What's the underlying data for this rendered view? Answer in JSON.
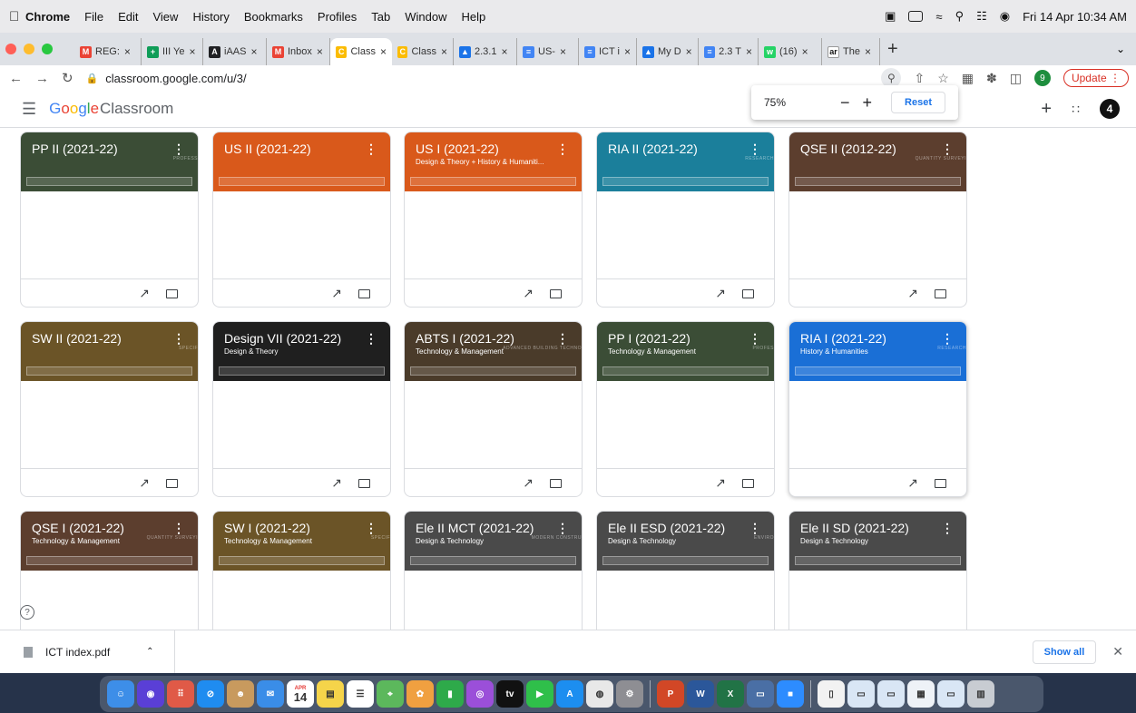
{
  "menubar": {
    "app": "Chrome",
    "items": [
      "File",
      "Edit",
      "View",
      "History",
      "Bookmarks",
      "Profiles",
      "Tab",
      "Window",
      "Help"
    ],
    "datetime": "Fri 14 Apr  10:34 AM"
  },
  "tabs": [
    {
      "label": "REG:",
      "icon": "gmail-icon",
      "color": "#ea4335",
      "glyph": "M"
    },
    {
      "label": "III Ye",
      "icon": "sheets-icon",
      "color": "#0f9d58",
      "glyph": "+"
    },
    {
      "label": "iAAS",
      "icon": "app-icon",
      "color": "#202124",
      "glyph": "A"
    },
    {
      "label": "Inbox",
      "icon": "gmail-icon",
      "color": "#ea4335",
      "glyph": "M"
    },
    {
      "label": "Class",
      "icon": "classroom-icon",
      "color": "#fbbc04",
      "glyph": "C",
      "active": true
    },
    {
      "label": "Class",
      "icon": "classroom-icon",
      "color": "#fbbc04",
      "glyph": "C"
    },
    {
      "label": "2.3.1",
      "icon": "drive-icon",
      "color": "#1a73e8",
      "glyph": "▲"
    },
    {
      "label": "US-",
      "icon": "docs-icon",
      "color": "#4285f4",
      "glyph": "≡"
    },
    {
      "label": "ICT i",
      "icon": "docs-icon",
      "color": "#4285f4",
      "glyph": "≡"
    },
    {
      "label": "My D",
      "icon": "drive-icon",
      "color": "#1a73e8",
      "glyph": "▲"
    },
    {
      "label": "2.3 T",
      "icon": "docs-icon",
      "color": "#4285f4",
      "glyph": "≡"
    },
    {
      "label": "(16)",
      "icon": "whatsapp-icon",
      "color": "#25d366",
      "glyph": "w"
    },
    {
      "label": "The",
      "icon": "ar-icon",
      "color": "#ffffff",
      "glyph": "ar"
    }
  ],
  "address": {
    "url": "classroom.google.com/u/3/",
    "profile_initial": "9",
    "update_label": "Update"
  },
  "header": {
    "logo_google": [
      "G",
      "o",
      "o",
      "g",
      "l",
      "e"
    ],
    "logo_classroom": "Classroom",
    "account_initial": "4"
  },
  "zoom": {
    "percent": "75%",
    "minus": "−",
    "plus": "+",
    "reset": "Reset"
  },
  "classes": [
    {
      "title": "PP II (2021-22)",
      "subtitle": "",
      "watermark": "PROFESS",
      "color": "#3b4d36"
    },
    {
      "title": "US II (2021-22)",
      "subtitle": "",
      "watermark": "",
      "color": "#d9591b"
    },
    {
      "title": "US I (2021-22)",
      "subtitle": "Design & Theory + History & Humaniti...",
      "watermark": "",
      "color": "#d9591b"
    },
    {
      "title": "RIA II (2021-22)",
      "subtitle": "",
      "watermark": "RESEARCH",
      "color": "#1b7f9b"
    },
    {
      "title": "QSE II (2012-22)",
      "subtitle": "",
      "watermark": "QUANTITY SURVEYI",
      "color": "#5c3e2e"
    },
    {
      "title": "SW II (2021-22)",
      "subtitle": "",
      "watermark": "SPECIF",
      "color": "#6b5427"
    },
    {
      "title": "Design VII (2021-22)",
      "subtitle": "Design & Theory",
      "watermark": "",
      "color": "#1f1f1f"
    },
    {
      "title": "ABTS I (2021-22)",
      "subtitle": "Technology & Management",
      "watermark": "ADVANCED BUILDING TECHNO",
      "color": "#4a3b2a"
    },
    {
      "title": "PP I (2021-22)",
      "subtitle": "Technology & Management",
      "watermark": "PROFES",
      "color": "#3b4d36"
    },
    {
      "title": "RIA I (2021-22)",
      "subtitle": "History & Humanities",
      "watermark": "RESEARCH",
      "color": "#1a6fd6"
    },
    {
      "title": "QSE I (2021-22)",
      "subtitle": "Technology & Management",
      "watermark": "QUANTITY SURVEYI",
      "color": "#5c3e2e"
    },
    {
      "title": "SW I (2021-22)",
      "subtitle": "Technology & Management",
      "watermark": "SPECIF",
      "color": "#6b5427"
    },
    {
      "title": "Ele II MCT (2021-22)",
      "subtitle": "Design & Technology",
      "watermark": "MODERN CONSTRU",
      "color": "#4a4a4a"
    },
    {
      "title": "Ele II ESD (2021-22)",
      "subtitle": "Design & Technology",
      "watermark": "ENVIRO",
      "color": "#4a4a4a"
    },
    {
      "title": "Ele II SD (2021-22)",
      "subtitle": "Design & Technology",
      "watermark": "",
      "color": "#4a4a4a"
    }
  ],
  "downloads": {
    "file": "ICT index.pdf",
    "show_all": "Show all"
  },
  "dock": {
    "calendar_month": "APR",
    "calendar_day": "14",
    "apps": [
      {
        "name": "finder-icon",
        "color": "#3d8ee8",
        "glyph": "☺"
      },
      {
        "name": "siri-icon",
        "color": "#5a3fd6",
        "glyph": "◉"
      },
      {
        "name": "launchpad-icon",
        "color": "#e05a47",
        "glyph": "⠿"
      },
      {
        "name": "safari-icon",
        "color": "#1f8cf0",
        "glyph": "⊘"
      },
      {
        "name": "contacts-icon",
        "color": "#c89a5e",
        "glyph": "☻"
      },
      {
        "name": "mail-icon",
        "color": "#3a8de8",
        "glyph": "✉"
      },
      {
        "name": "calendar-icon",
        "color": "#ffffff",
        "glyph": ""
      },
      {
        "name": "notes-icon",
        "color": "#f5d44a",
        "glyph": "▤"
      },
      {
        "name": "reminders-icon",
        "color": "#ffffff",
        "glyph": "☰"
      },
      {
        "name": "maps-icon",
        "color": "#5cb85c",
        "glyph": "⌖"
      },
      {
        "name": "photos-icon",
        "color": "#f0a040",
        "glyph": "✿"
      },
      {
        "name": "numbers-icon",
        "color": "#2eaa4a",
        "glyph": "▮"
      },
      {
        "name": "podcasts-icon",
        "color": "#9b4fd9",
        "glyph": "◎"
      },
      {
        "name": "appletv-icon",
        "color": "#111111",
        "glyph": "tv"
      },
      {
        "name": "facetime-icon",
        "color": "#2fbf4a",
        "glyph": "▶"
      },
      {
        "name": "appstore-icon",
        "color": "#1c8ef0",
        "glyph": "A"
      },
      {
        "name": "chrome-icon",
        "color": "#e8e8e8",
        "glyph": "◍"
      },
      {
        "name": "settings-icon",
        "color": "#8e8e93",
        "glyph": "⚙"
      },
      {
        "name": "powerpoint-icon",
        "color": "#d24726",
        "glyph": "P"
      },
      {
        "name": "word-icon",
        "color": "#2b579a",
        "glyph": "W"
      },
      {
        "name": "excel-icon",
        "color": "#217346",
        "glyph": "X"
      },
      {
        "name": "remote-icon",
        "color": "#4a6fa5",
        "glyph": "▭"
      },
      {
        "name": "zoom-icon",
        "color": "#2d8cff",
        "glyph": "■"
      },
      {
        "name": "document-icon",
        "color": "#f2f2f2",
        "glyph": "▯"
      },
      {
        "name": "screenshot-icon",
        "color": "#d9e6f5",
        "glyph": "▭"
      },
      {
        "name": "screenshot-icon",
        "color": "#d9e6f5",
        "glyph": "▭"
      },
      {
        "name": "document-icon",
        "color": "#eef2f7",
        "glyph": "▦"
      },
      {
        "name": "screenshot-icon",
        "color": "#d9e6f5",
        "glyph": "▭"
      },
      {
        "name": "trash-icon",
        "color": "#c8ccd2",
        "glyph": "▥"
      }
    ]
  }
}
